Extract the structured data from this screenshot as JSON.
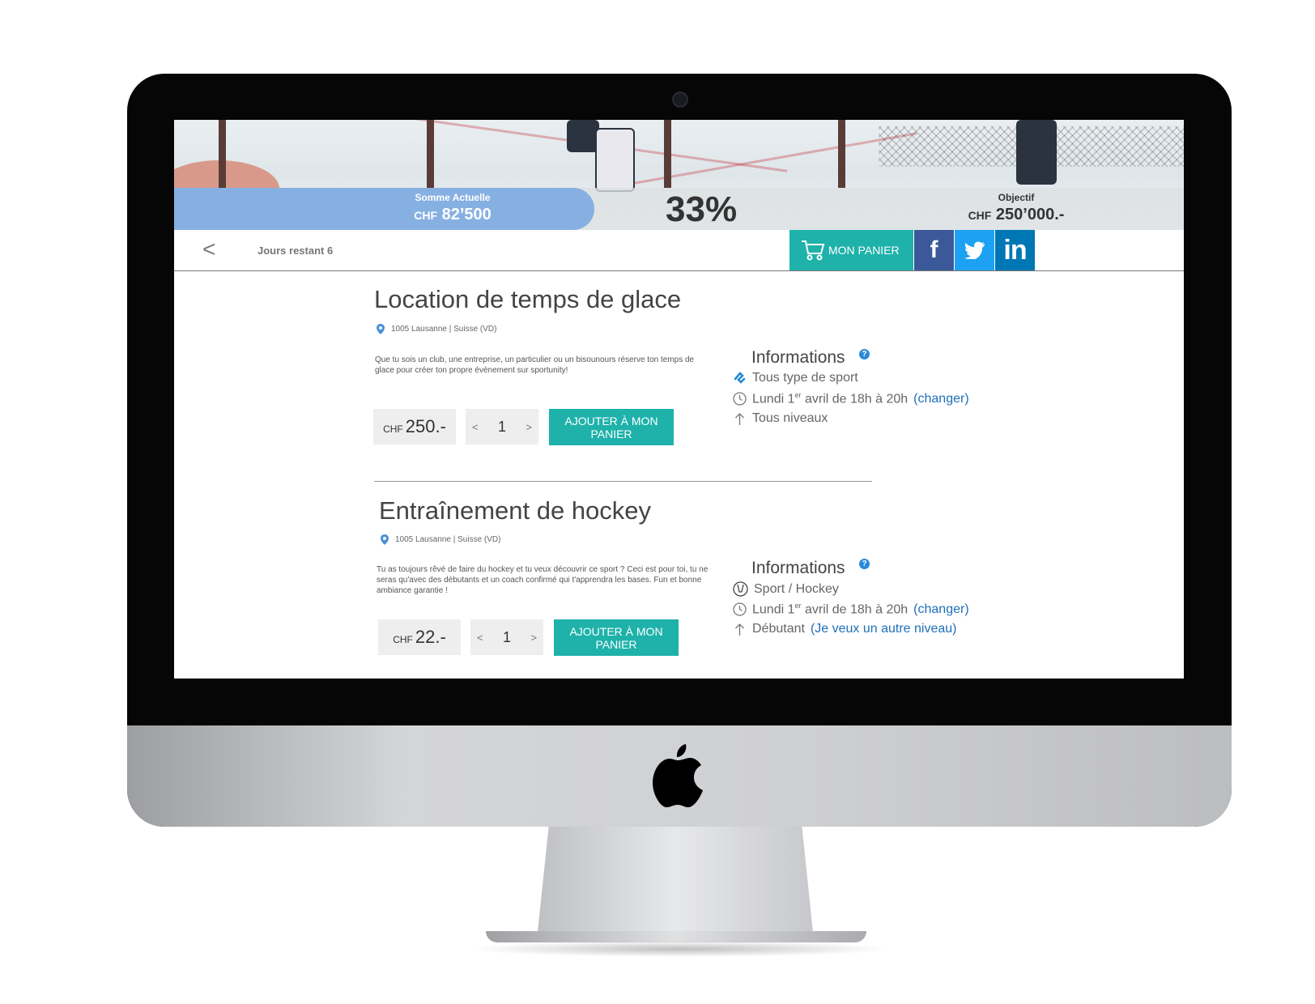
{
  "hero": {
    "current_label": "Somme Actuelle",
    "current_currency": "CHF",
    "current_amount": "82’500",
    "percent": "33%",
    "progress_fraction": 0.33,
    "goal_label": "Objectif",
    "goal_currency": "CHF",
    "goal_amount": "250’000.-"
  },
  "nav": {
    "back_glyph": "<",
    "days_remaining": "Jours restant 6",
    "cart_label": "MON PANIER",
    "social": [
      "f",
      "in"
    ]
  },
  "products": [
    {
      "title": "Location de temps de glace",
      "location": "1005 Lausanne | Suisse (VD)",
      "description": "Que tu sois un club, une entreprise, un particulier ou un bisounours réserve ton temps de glace pour créer ton propre évènement sur sportunity!",
      "currency": "CHF",
      "price": "250.-",
      "qty_prev": "<",
      "quantity": "1",
      "qty_next": ">",
      "add_label": "AJOUTER À MON PANIER",
      "info_title": "Informations",
      "help": "?",
      "sport": "Tous type de sport",
      "date_pre": "Lundi 1",
      "date_sup": "er",
      "date_post": " avril de 18h à 20h",
      "date_link": "(changer)",
      "level": "Tous niveaux",
      "level_link": ""
    },
    {
      "title": "Entraînement de hockey",
      "location": "1005 Lausanne | Suisse (VD)",
      "description": "Tu as toujours rêvé de faire du hockey et tu veux découvrir ce sport ? Ceci est pour toi, tu ne seras qu'avec des débutants et un coach confirmé qui t'apprendra les bases. Fun et bonne ambiance garantie !",
      "currency": "CHF",
      "price": "22.-",
      "qty_prev": "<",
      "quantity": "1",
      "qty_next": ">",
      "add_label": "AJOUTER À MON PANIER",
      "info_title": "Informations",
      "help": "?",
      "sport": "Sport / Hockey",
      "date_pre": "Lundi 1",
      "date_sup": "er",
      "date_post": " avril de 18h à 20h",
      "date_link": "(changer)",
      "level": "Débutant",
      "level_link": "(Je veux un autre niveau)"
    }
  ],
  "colors": {
    "accent": "#1eb2aa",
    "progress": "#87b0e2",
    "link": "#1e6fb8",
    "facebook": "#3b5998",
    "twitter": "#1da1f2",
    "linkedin": "#0077b5"
  }
}
